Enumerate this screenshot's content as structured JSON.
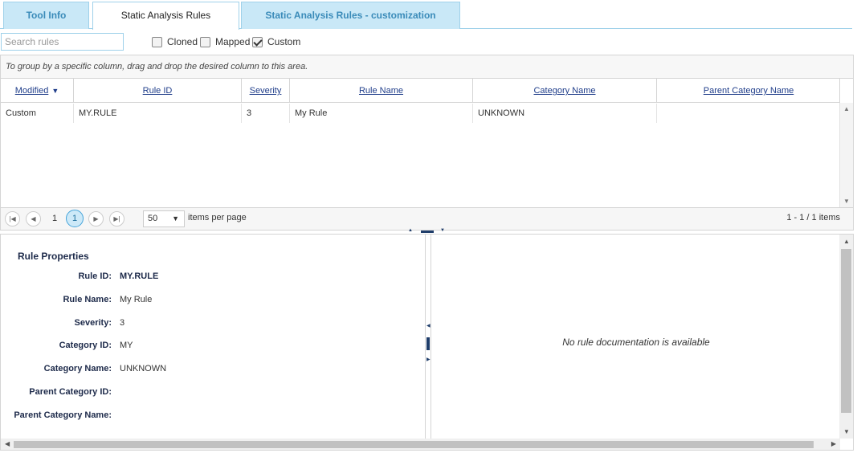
{
  "tabs": [
    {
      "label": "Tool Info"
    },
    {
      "label": "Static Analysis Rules"
    },
    {
      "label": "Static Analysis Rules - customization"
    }
  ],
  "toolbar": {
    "search_placeholder": "Search rules",
    "filters": [
      {
        "label": "Cloned",
        "checked": false
      },
      {
        "label": "Mapped",
        "checked": false
      },
      {
        "label": "Custom",
        "checked": true
      }
    ]
  },
  "grid": {
    "group_hint": "To group by a specific column, drag and drop the desired column to this area.",
    "columns": [
      "Modified",
      "Rule ID",
      "Severity",
      "Rule Name",
      "Category Name",
      "Parent Category Name"
    ],
    "sorted_column": "Modified",
    "sort_direction": "descending",
    "rows": [
      {
        "modified": "Custom",
        "rule_id": "MY.RULE",
        "severity": "3",
        "rule_name": "My Rule",
        "category_name": "UNKNOWN",
        "parent_category_name": ""
      }
    ]
  },
  "pager": {
    "first_page": "1",
    "current_page": "1",
    "items_per_page": "50",
    "items_per_page_label": "items per page",
    "range_text": "1 - 1 / 1 items"
  },
  "properties": {
    "title": "Rule Properties",
    "fields": [
      {
        "key": "Rule ID:",
        "value": "MY.RULE"
      },
      {
        "key": "Rule Name:",
        "value": "My Rule"
      },
      {
        "key": "Severity:",
        "value": "3"
      },
      {
        "key": "Category ID:",
        "value": "MY"
      },
      {
        "key": "Category Name:",
        "value": "UNKNOWN"
      },
      {
        "key": "Parent Category ID:",
        "value": ""
      },
      {
        "key": "Parent Category Name:",
        "value": ""
      }
    ]
  },
  "documentation": {
    "empty_text": "No rule documentation is available"
  },
  "colors": {
    "tab_active_bg": "#ffffff",
    "tab_bg": "#c9e8f7",
    "tab_text": "#3a8bb9",
    "header_link": "#1f3d8a",
    "pager_current_bg": "#cde9f8"
  }
}
